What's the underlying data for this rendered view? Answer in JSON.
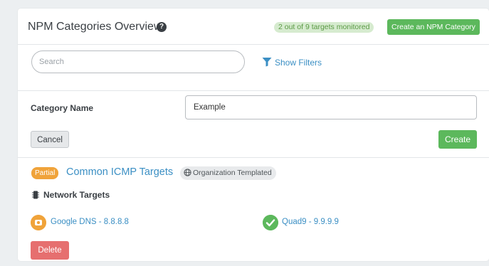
{
  "header": {
    "title": "NPM Categories Overview",
    "help_icon": "question-circle-icon",
    "monitored_text": "2 out of 9 targets monitored",
    "create_npm_label": "Create an NPM Category"
  },
  "search": {
    "placeholder": "Search",
    "value": "",
    "show_filters_label": "Show Filters",
    "filter_icon": "filter-icon"
  },
  "form": {
    "category_name_label": "Category Name",
    "category_name_value": "Example",
    "cancel_label": "Cancel",
    "create_label": "Create"
  },
  "category": {
    "status_badge": "Partial",
    "name": "Common ICMP Targets",
    "org_badge": "Organization Templated",
    "network_targets_title": "Network Targets",
    "targets": [
      {
        "label": "Google DNS - 8.8.8.8",
        "status": "warning",
        "icon": "warning-icon"
      },
      {
        "label": "Quad9 - 9.9.9.9",
        "status": "ok",
        "icon": "check-circle-icon"
      }
    ],
    "delete_label": "Delete"
  },
  "colors": {
    "accent_green": "#5cb85c",
    "link_blue": "#3b8fc4",
    "partial_orange": "#f0a33a",
    "delete_red": "#e66f6f"
  }
}
